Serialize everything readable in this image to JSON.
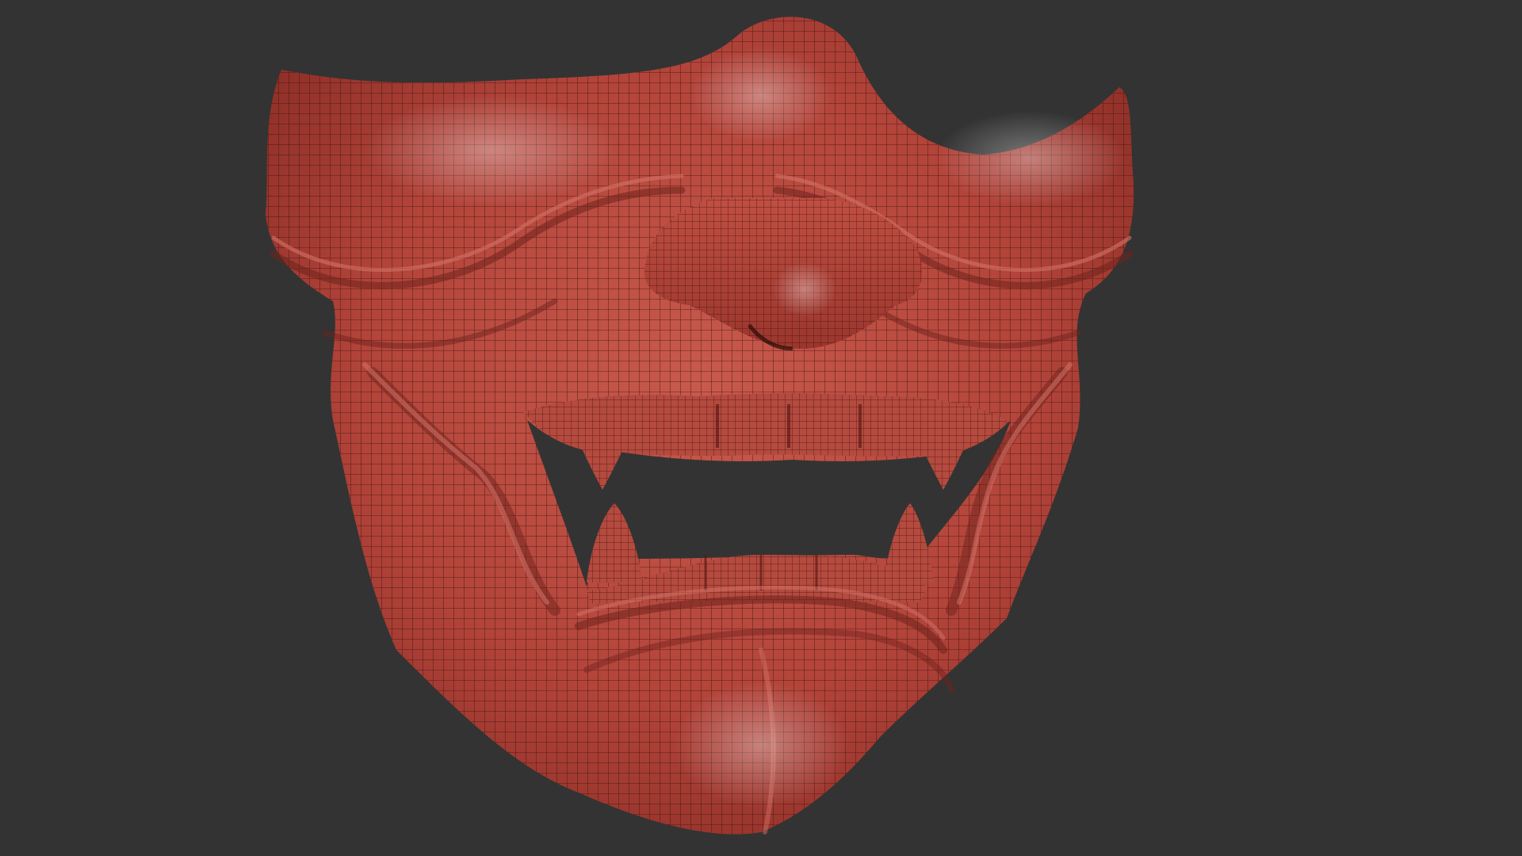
{
  "viewport": {
    "background_color": "#333333",
    "object": "mesh-wireframe-oni-mask",
    "colors": {
      "surface": "#b2443a",
      "surface_highlight": "#cf6a5e",
      "surface_shadow": "#6e221c",
      "wireframe": "#3a0f0c"
    }
  }
}
